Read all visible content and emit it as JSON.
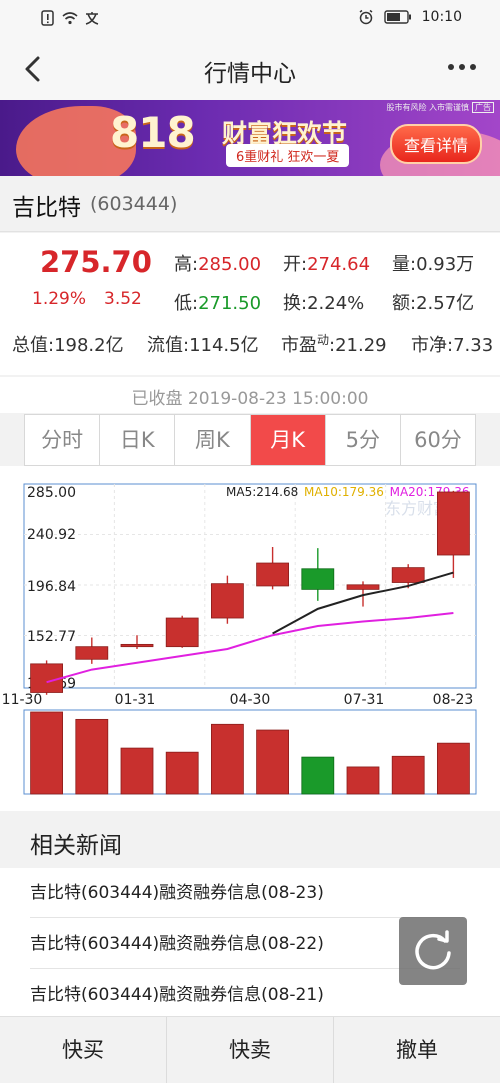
{
  "status_bar": {
    "time": "10:10"
  },
  "nav": {
    "title": "行情中心"
  },
  "banner": {
    "big_text": "818",
    "fest_text": "财富狂欢节",
    "pill_text": "6重财礼 狂欢一夏",
    "cta": "查看详情",
    "disclaimer": "股市有风险 入市需谨慎",
    "ad_tag": "广告"
  },
  "stock": {
    "name": "吉比特",
    "code": "(603444)"
  },
  "quote": {
    "price": "275.70",
    "pct": "1.29%",
    "change": "3.52",
    "high_label": "高:",
    "high": "285.00",
    "open_label": "开:",
    "open": "274.64",
    "volume_label": "量:",
    "volume": "0.93万",
    "low_label": "低:",
    "low": "271.50",
    "turnover_label": "换:",
    "turnover": "2.24%",
    "amount_label": "额:",
    "amount": "2.57亿",
    "total_cap_label": "总值:",
    "total_cap": "198.2亿",
    "float_cap_label": "流值:",
    "float_cap": "114.5亿",
    "pe_label": "市盈",
    "pe_sup": "动",
    "pe": ":21.29",
    "pb_label": "市净:",
    "pb": "7.33"
  },
  "market_status": "已收盘 2019-08-23 15:00:00",
  "tabs": [
    {
      "label": "分时",
      "active": false
    },
    {
      "label": "日K",
      "active": false
    },
    {
      "label": "周K",
      "active": false
    },
    {
      "label": "月K",
      "active": true
    },
    {
      "label": "5分",
      "active": false
    },
    {
      "label": "60分",
      "active": false
    }
  ],
  "chart_data": {
    "type": "candlestick",
    "y_ticks": [
      "285.00",
      "240.92",
      "196.84",
      "152.77",
      "108.69"
    ],
    "ylim": [
      108.69,
      285.0
    ],
    "x_labels": [
      "11-30",
      "01-31",
      "04-30",
      "07-31",
      "08-23"
    ],
    "watermark": "东方财富",
    "ma_legend": [
      {
        "name": "MA5:",
        "value": "214.68",
        "color": "#222222"
      },
      {
        "name": "MA10:",
        "value": "179.36",
        "color": "#e0b000"
      },
      {
        "name": "MA20:",
        "value": "179.36",
        "color": "#e020e0"
      }
    ],
    "candles": [
      {
        "open": 110,
        "close": 135,
        "high": 138,
        "low": 108
      },
      {
        "open": 139,
        "close": 150,
        "high": 158,
        "low": 135
      },
      {
        "open": 150,
        "close": 152,
        "high": 160,
        "low": 148
      },
      {
        "open": 150,
        "close": 175,
        "high": 177,
        "low": 149
      },
      {
        "open": 175,
        "close": 205,
        "high": 212,
        "low": 170
      },
      {
        "open": 203,
        "close": 223,
        "high": 237,
        "low": 200
      },
      {
        "open": 218,
        "close": 200,
        "high": 236,
        "low": 190
      },
      {
        "open": 200,
        "close": 204,
        "high": 207,
        "low": 185
      },
      {
        "open": 206,
        "close": 219,
        "high": 222,
        "low": 201
      },
      {
        "open": 230,
        "close": 285,
        "high": 286,
        "low": 210
      }
    ],
    "ma5": [
      null,
      null,
      null,
      null,
      null,
      161.5,
      183,
      195,
      203,
      214.68
    ],
    "ma20": [
      119,
      130,
      136,
      142,
      148,
      160,
      168,
      172,
      175,
      179.36
    ],
    "volumes": [
      100,
      91,
      56,
      51,
      85,
      78,
      45,
      33,
      46,
      62
    ]
  },
  "news": {
    "title": "相关新闻",
    "items": [
      "吉比特(603444)融资融券信息(08-23)",
      "吉比特(603444)融资融券信息(08-22)",
      "吉比特(603444)融资融券信息(08-21)"
    ]
  },
  "bottom_bar": {
    "buy": "快买",
    "sell": "快卖",
    "cancel": "撤单"
  }
}
